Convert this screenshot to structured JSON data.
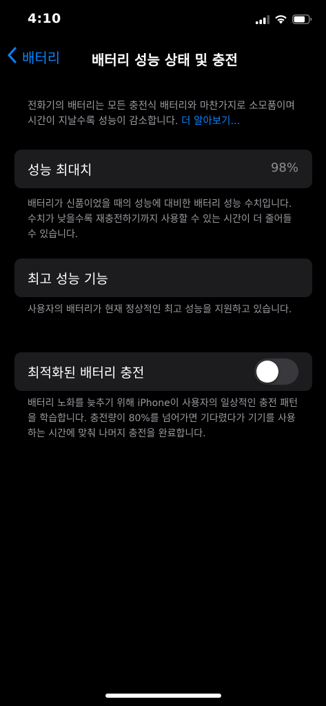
{
  "status_bar": {
    "time": "4:10",
    "icons": [
      "cellular-signal-icon",
      "wifi-icon",
      "battery-icon"
    ]
  },
  "nav": {
    "back_label": "배터리",
    "title": "배터리 성능 상태 및 충전"
  },
  "intro": {
    "text": "전화기의 배터리는 모든 충전식 배터리와 마찬가지로 소모품이며 시간이 지날수록 성능이 감소합니다. ",
    "learn_more": "더 알아보기..."
  },
  "max_capacity": {
    "label": "성능 최대치",
    "value": "98%",
    "footnote": "배터리가 신품이었을 때의 성능에 대비한 배터리 성능 수치입니다. 수치가 낮을수록 재충전하기까지 사용할 수 있는 시간이 더 줄어들 수 있습니다."
  },
  "peak_performance": {
    "label": "최고 성능 기능",
    "footnote": "사용자의 배터리가 현재 정상적인 최고 성능을 지원하고 있습니다."
  },
  "optimized_charging": {
    "label": "최적화된 배터리 충전",
    "enabled": false,
    "footnote": "배터리 노화를 늦추기 위해 iPhone이 사용자의 일상적인 충전 패턴을 학습합니다. 충전량이 80%를 넘어가면 기다렸다가 기기를 사용하는 시간에 맞춰 나머지 충전을 완료합니다."
  },
  "colors": {
    "accent": "#0a84ff",
    "background": "#000000",
    "card": "#1c1c1e",
    "secondary_text": "#9a9aa0",
    "toggle_off": "#39393d"
  }
}
